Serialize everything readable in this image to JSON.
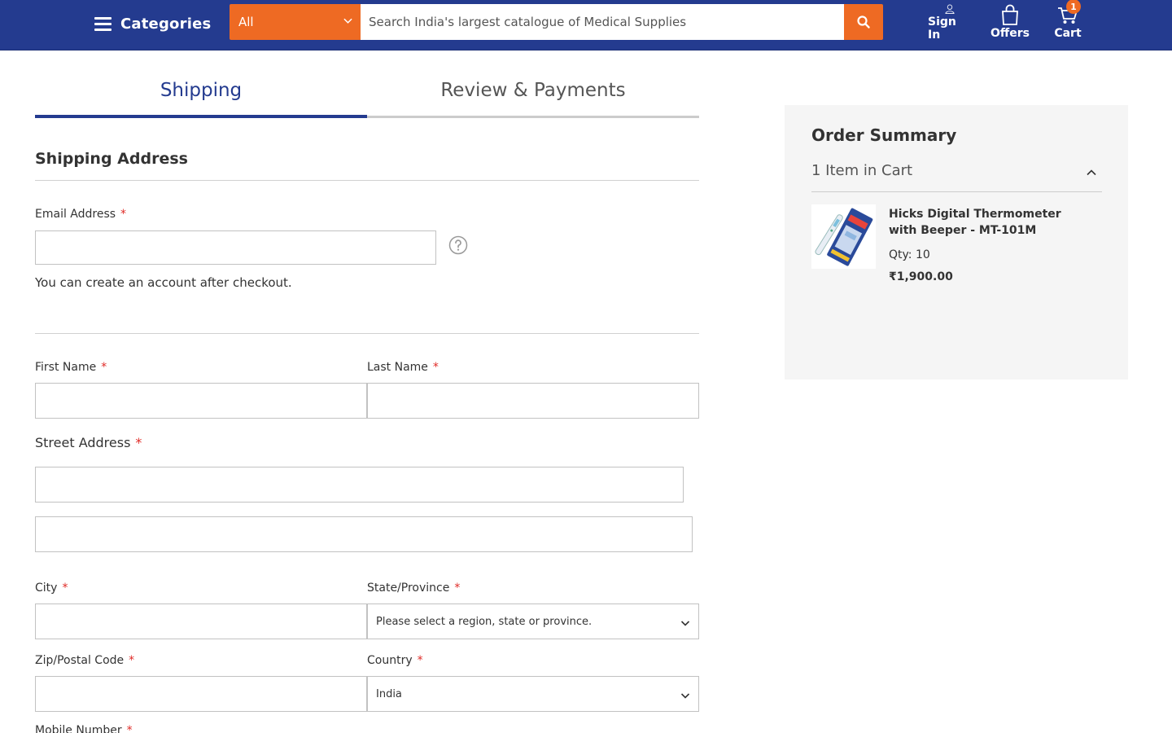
{
  "header": {
    "categories_label": "Categories",
    "search": {
      "category_value": "All",
      "placeholder": "Search India's largest catalogue of Medical Supplies"
    },
    "links": {
      "signin": "Sign In",
      "offers": "Offers",
      "cart": "Cart"
    },
    "cart_count": "1",
    "colors": {
      "bar": "#243b8f",
      "accent": "#ee6a23"
    }
  },
  "progress": {
    "steps": [
      {
        "label": "Shipping",
        "active": true
      },
      {
        "label": "Review & Payments",
        "active": false
      }
    ]
  },
  "shipping": {
    "title": "Shipping Address",
    "required_marker": "*",
    "email_label": "Email Address",
    "email_note": "You can create an account after checkout.",
    "first_name_label": "First Name",
    "last_name_label": "Last Name",
    "street_label": "Street Address",
    "city_label": "City",
    "state_label": "State/Province",
    "state_value": "Please select a region, state or province.",
    "zip_label": "Zip/Postal Code",
    "country_label": "Country",
    "country_value": "India",
    "mobile_label": "Mobile Number"
  },
  "summary": {
    "title": "Order Summary",
    "item_count": "1 Item in Cart",
    "items": [
      {
        "name": "Hicks Digital Thermometer with Beeper - MT-101M",
        "qty": "Qty: 10",
        "price": "₹1,900.00"
      }
    ]
  }
}
